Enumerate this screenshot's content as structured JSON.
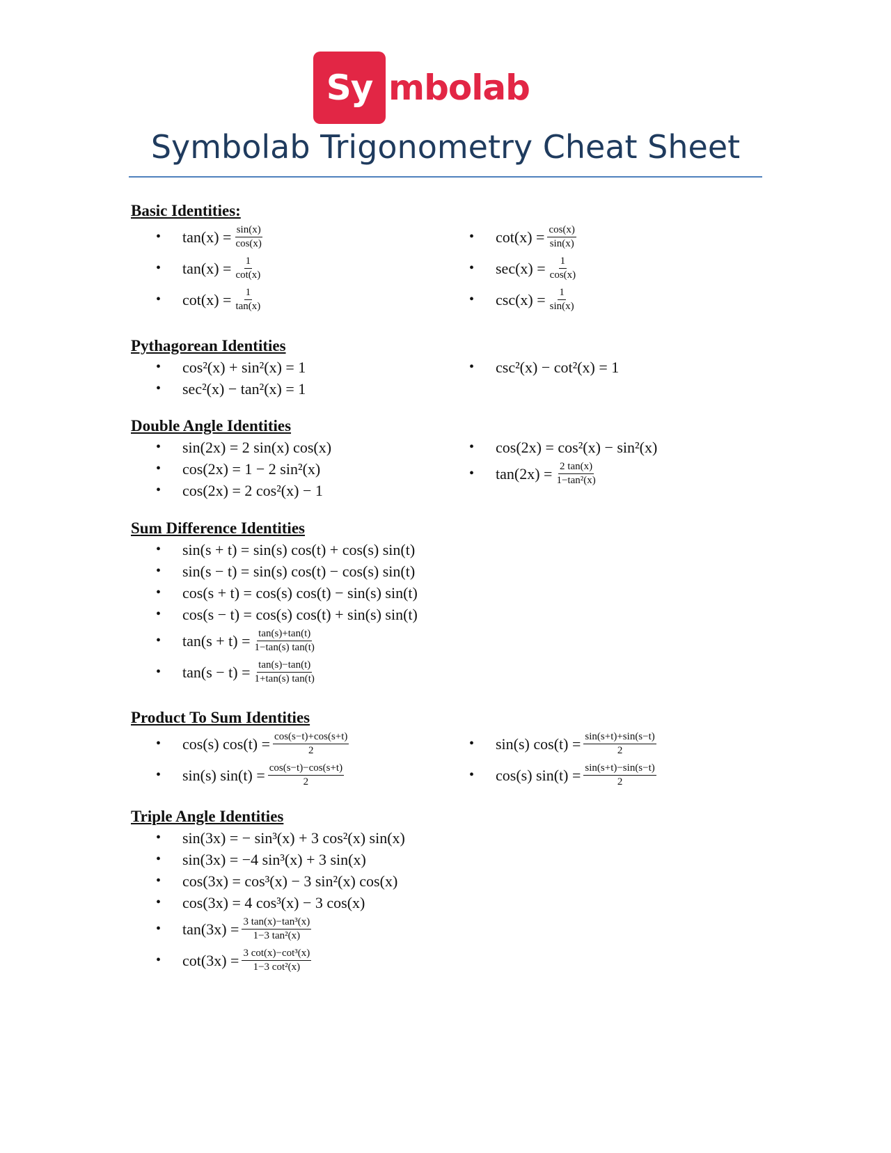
{
  "logo": {
    "box_text": "Sy",
    "rest_text": "mbolab",
    "brand_color": "#e22645"
  },
  "title": "Symbolab Trigonometry Cheat Sheet",
  "sections": {
    "basic": {
      "title": "Basic Identities:",
      "left": [
        {
          "lhs": "tan(x) =",
          "num": "sin(x)",
          "den": "cos(x)"
        },
        {
          "lhs": "tan(x) =",
          "num": "1",
          "den": "cot(x)"
        },
        {
          "lhs": "cot(x) =",
          "num": "1",
          "den": "tan(x)"
        }
      ],
      "right": [
        {
          "lhs": "cot(x) =",
          "num": "cos(x)",
          "den": "sin(x)"
        },
        {
          "lhs": "sec(x) =",
          "num": "1",
          "den": "cos(x)"
        },
        {
          "lhs": "csc(x) =",
          "num": "1",
          "den": "sin(x)"
        }
      ]
    },
    "pythagorean": {
      "title": "Pythagorean Identities",
      "left": [
        "cos²(x) + sin²(x) = 1",
        "sec²(x) − tan²(x) = 1"
      ],
      "right": [
        "csc²(x) − cot²(x) = 1"
      ]
    },
    "double": {
      "title": "Double Angle Identities",
      "left": [
        "sin(2x) = 2 sin(x) cos(x)",
        "cos(2x) = 1 − 2 sin²(x)",
        "cos(2x) = 2 cos²(x) − 1"
      ],
      "right_simple": "cos(2x) = cos²(x) − sin²(x)",
      "right_frac": {
        "lhs": "tan(2x) =",
        "num": "2 tan(x)",
        "den": "1−tan²(x)"
      }
    },
    "sumdiff": {
      "title": "Sum Difference Identities",
      "simple": [
        "sin(s + t) = sin(s) cos(t) + cos(s) sin(t)",
        "sin(s − t) = sin(s) cos(t) − cos(s) sin(t)",
        "cos(s + t) = cos(s) cos(t) − sin(s) sin(t)",
        "cos(s − t) = cos(s) cos(t) + sin(s) sin(t)"
      ],
      "frac": [
        {
          "lhs": "tan(s + t) =",
          "num": "tan(s)+tan(t)",
          "den": "1−tan(s) tan(t)"
        },
        {
          "lhs": "tan(s − t) =",
          "num": "tan(s)−tan(t)",
          "den": "1+tan(s) tan(t)"
        }
      ]
    },
    "product": {
      "title": "Product To Sum Identities",
      "left": [
        {
          "lhs": "cos(s) cos(t) =",
          "num": "cos(s−t)+cos(s+t)",
          "den": "2"
        },
        {
          "lhs": "sin(s) sin(t) =",
          "num": "cos(s−t)−cos(s+t)",
          "den": "2"
        }
      ],
      "right": [
        {
          "lhs": "sin(s) cos(t) =",
          "num": "sin(s+t)+sin(s−t)",
          "den": "2"
        },
        {
          "lhs": "cos(s) sin(t) =",
          "num": "sin(s+t)−sin(s−t)",
          "den": "2"
        }
      ]
    },
    "triple": {
      "title": "Triple Angle Identities",
      "simple": [
        "sin(3x) = − sin³(x) + 3 cos²(x) sin(x)",
        "sin(3x) = −4 sin³(x) + 3 sin(x)",
        "cos(3x) = cos³(x) − 3 sin²(x) cos(x)",
        "cos(3x) = 4 cos³(x) − 3 cos(x)"
      ],
      "frac": [
        {
          "lhs": "tan(3x) =",
          "num": "3 tan(x)−tan³(x)",
          "den": "1−3 tan²(x)"
        },
        {
          "lhs": "cot(3x) =",
          "num": "3 cot(x)−cot³(x)",
          "den": "1−3 cot²(x)"
        }
      ]
    }
  },
  "bullet": "•"
}
